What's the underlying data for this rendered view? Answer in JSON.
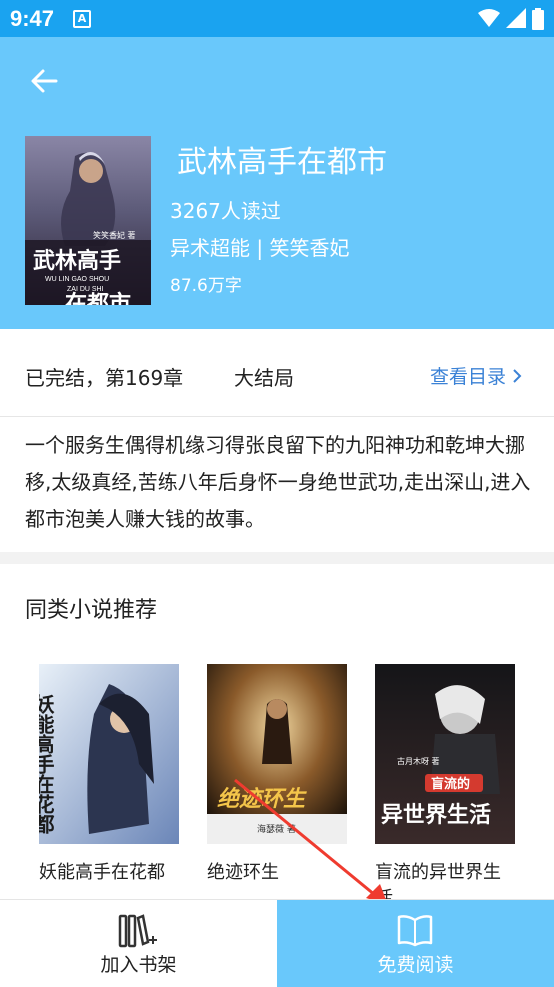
{
  "status_bar": {
    "time": "9:47",
    "notification_letter": "A"
  },
  "book": {
    "title": "武林高手在都市",
    "readers": "3267人读过",
    "genre_author": "异术超能 | 笑笑香妃",
    "word_count": "87.6万字",
    "cover": {
      "author_tag": "笑笑香妃 著",
      "title_text": "武林高手",
      "title_text_2": "在都市",
      "pinyin": "WU LIN GAO SHOU",
      "pinyin_2": "ZAI DU SHI"
    }
  },
  "status_row": {
    "chapter_info": "已完结，第169章",
    "final_chapter": "大结局",
    "toc_label": "查看目录"
  },
  "description": "一个服务生偶得机缘习得张良留下的九阳神功和乾坤大挪移,太级真经,苦练八年后身怀一身绝世武功,走出深山,进入都市泡美人赚大钱的故事。",
  "recommendations": {
    "title": "同类小说推荐",
    "items": [
      {
        "label": "妖能高手在花都",
        "cover_text": "妖能高手在花都"
      },
      {
        "label": "绝迹环生",
        "cover_text": "绝迹环生",
        "cover_author": "海瑟薇 著"
      },
      {
        "label": "盲流的异世界生活",
        "cover_text": "异世界生活",
        "cover_text_top": "盲流的",
        "cover_author": "古月木呀 著"
      }
    ]
  },
  "bottom_bar": {
    "add_shelf_label": "加入书架",
    "free_read_label": "免费阅读"
  },
  "colors": {
    "header": "#69c8fb",
    "status_bar": "#1aa3f0",
    "link": "#3b82d6",
    "annotation_arrow": "#ef3b2f"
  }
}
